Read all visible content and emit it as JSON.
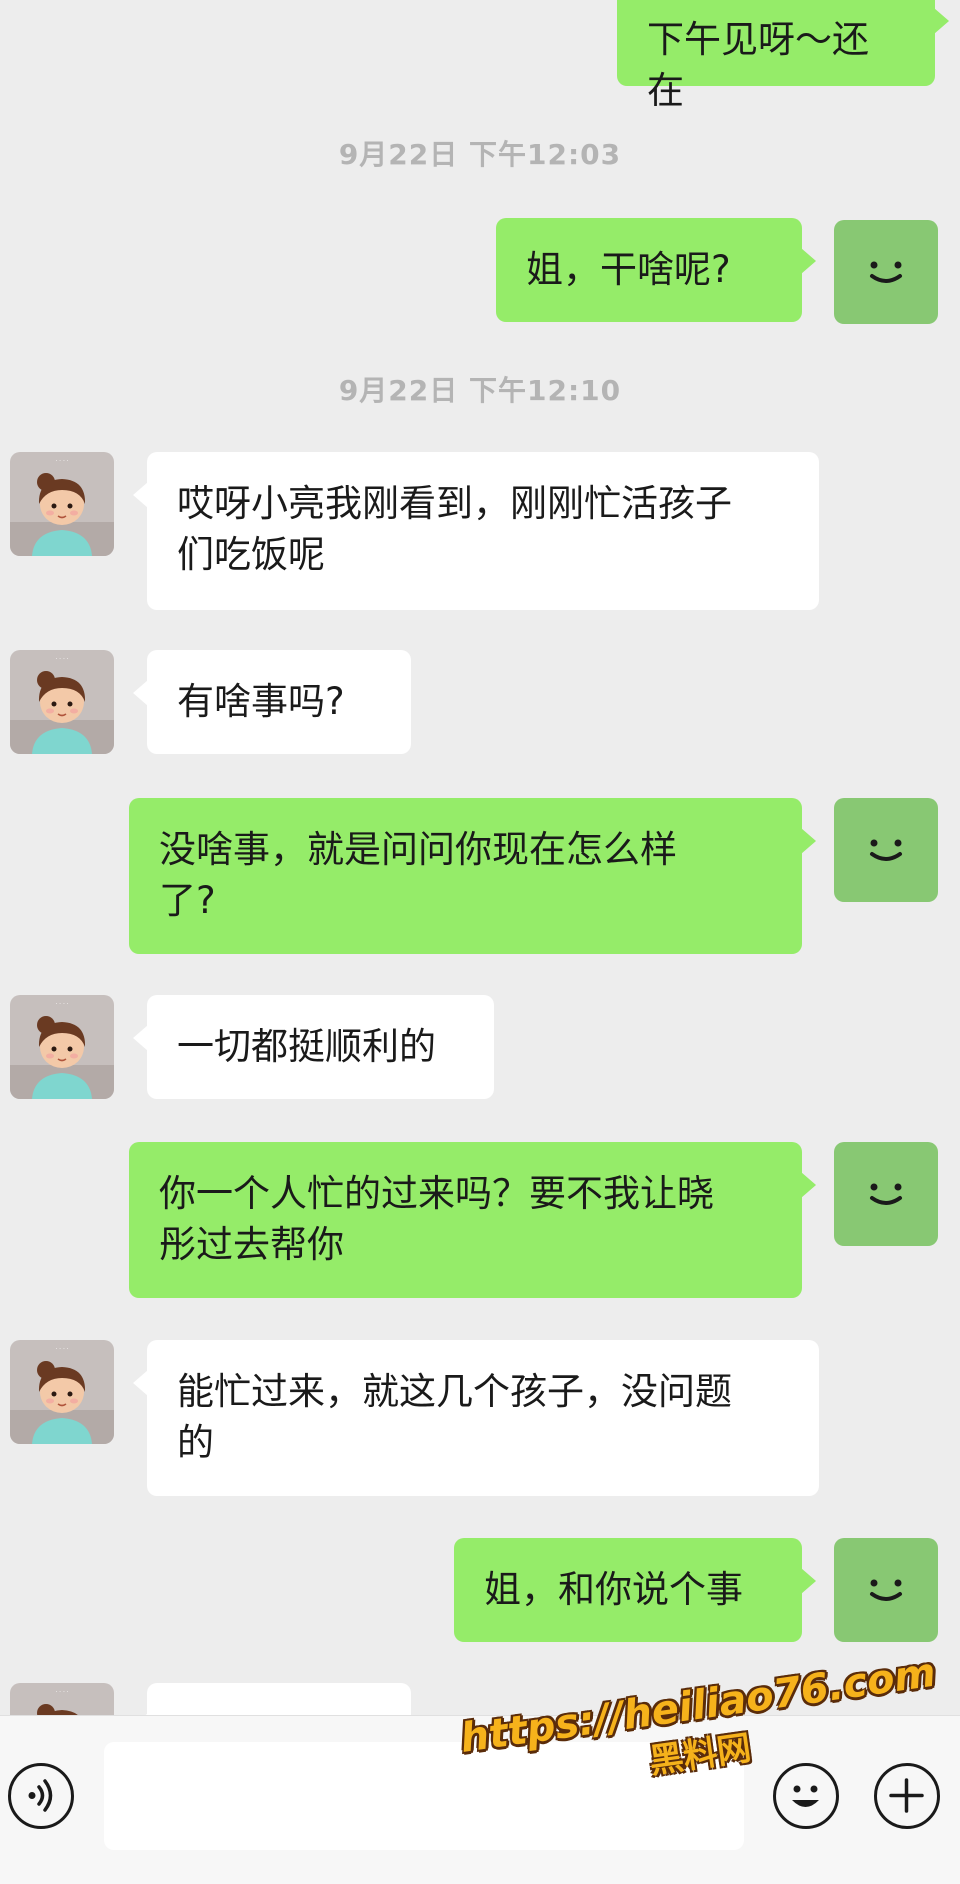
{
  "messages": {
    "m0": "下午见呀～还在",
    "ts1": "9月22日 下午12:03",
    "m1": "姐，干啥呢?",
    "ts2": "9月22日 下午12:10",
    "m2": "哎呀小亮我刚看到，刚刚忙活孩子\n们吃饭呢",
    "m3": "有啥事吗?",
    "m4": "没啥事，就是问问你现在怎么样\n了?",
    "m5": "一切都挺顺利的",
    "m6": "你一个人忙的过来吗？要不我让晓\n彤过去帮你",
    "m7": "能忙过来，就这几个孩子，没问题\n的",
    "m8": "姐，和你说个事",
    "m9": ""
  },
  "icons": {
    "voice": "voice-icon",
    "emoji": "emoji-icon",
    "plus": "plus-icon",
    "avatar_me": "smile-avatar",
    "avatar_her": "cartoon-girl-avatar"
  },
  "colors": {
    "me_bubble": "#95ec69",
    "her_bubble": "#ffffff",
    "background": "#ededed",
    "me_avatar": "#88c873"
  },
  "watermark": {
    "url": "https://heiliao76.com",
    "name": "黑料网"
  }
}
